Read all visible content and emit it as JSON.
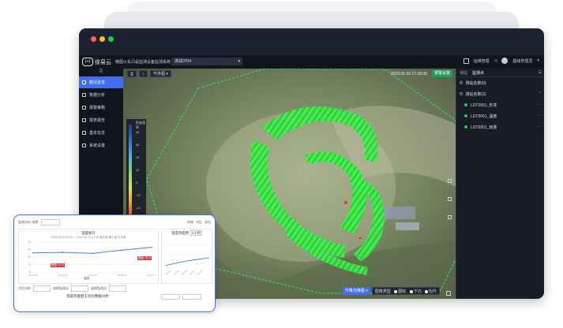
{
  "app": {
    "logo_mark": "(∞)",
    "logo_text": "徐易云",
    "system_title": "精图火车凸是监测设备监测系统",
    "project": "测试0704",
    "top_right": {
      "label1": "运维管理",
      "user": "超级管理员"
    }
  },
  "sidebar": {
    "collapse": "☰",
    "items": [
      {
        "label": "概况总览",
        "active": true
      },
      {
        "label": "数据分析"
      },
      {
        "label": "报警策略"
      },
      {
        "label": "报表报告"
      },
      {
        "label": "基本信息"
      },
      {
        "label": "系统设置"
      }
    ]
  },
  "map": {
    "tool_icon1": "⎙",
    "tool_icon2": "⌂",
    "tool_select": "升序图",
    "timestamp": "2023-05-30 17:28:38",
    "alarm_button": "报警设置",
    "legend": {
      "title": "形变速率",
      "ticks": [
        "48",
        "36",
        "24",
        "12",
        "0",
        "-12",
        "-24",
        "-36"
      ]
    },
    "bottom": {
      "mode_button": "升降沉降图",
      "display_label": "图像类型",
      "opt1": "图标",
      "opt2": "下沉",
      "opt3": "抬升"
    }
  },
  "right_panel": {
    "tabs": [
      "测站",
      "监测点"
    ],
    "groups": [
      {
        "label": "测站名称(0)",
        "expanded": false
      },
      {
        "label": "测站名称(3)",
        "expanded": true
      }
    ],
    "stations": [
      {
        "name": "LDT0001_形变"
      },
      {
        "name": "LDT0001_温度"
      },
      {
        "name": "LDT0001_雨量"
      }
    ]
  },
  "card": {
    "top": {
      "label": "监测分析-选择",
      "right1": "系统",
      "right2": "对比",
      "right3": "导出"
    },
    "left_chart": {
      "title": "温度统计",
      "subtitle": "2023-05-30 09:00 — 2023-05-30 17:00  最大值 最小值 平均值",
      "badge_low": "最低: 17.5",
      "badge_high": "最高: 21.5",
      "legend": "温度",
      "y_ticks": [
        "25",
        "20",
        "15",
        "10",
        "5"
      ],
      "x_ticks": [
        "05-30 09",
        "05-30 11",
        "05-30 13",
        "05-30 15",
        "05-30 17"
      ]
    },
    "right_chart": {
      "title": "温度热趋势",
      "tab": "1小时"
    },
    "bottom": {
      "label1": "对比分析",
      "label2": "选择监测点",
      "label3": "选择监测点",
      "title": "温度热量趋于对比数据分析"
    }
  },
  "chart_data": {
    "type": "line",
    "title": "温度统计",
    "x": [
      "05-30 09",
      "05-30 11",
      "05-30 13",
      "05-30 15",
      "05-30 17"
    ],
    "series": [
      {
        "name": "温度",
        "values": [
          17.8,
          18.1,
          17.5,
          19.6,
          21.5
        ]
      }
    ],
    "ylim": [
      5,
      25
    ],
    "color": "#2f6fdf"
  },
  "colors": {
    "accent": "#3f6ff0",
    "panel_bg": "#161a23",
    "point_cloud": "#3ff24a",
    "alarm": "#1aa05a"
  }
}
